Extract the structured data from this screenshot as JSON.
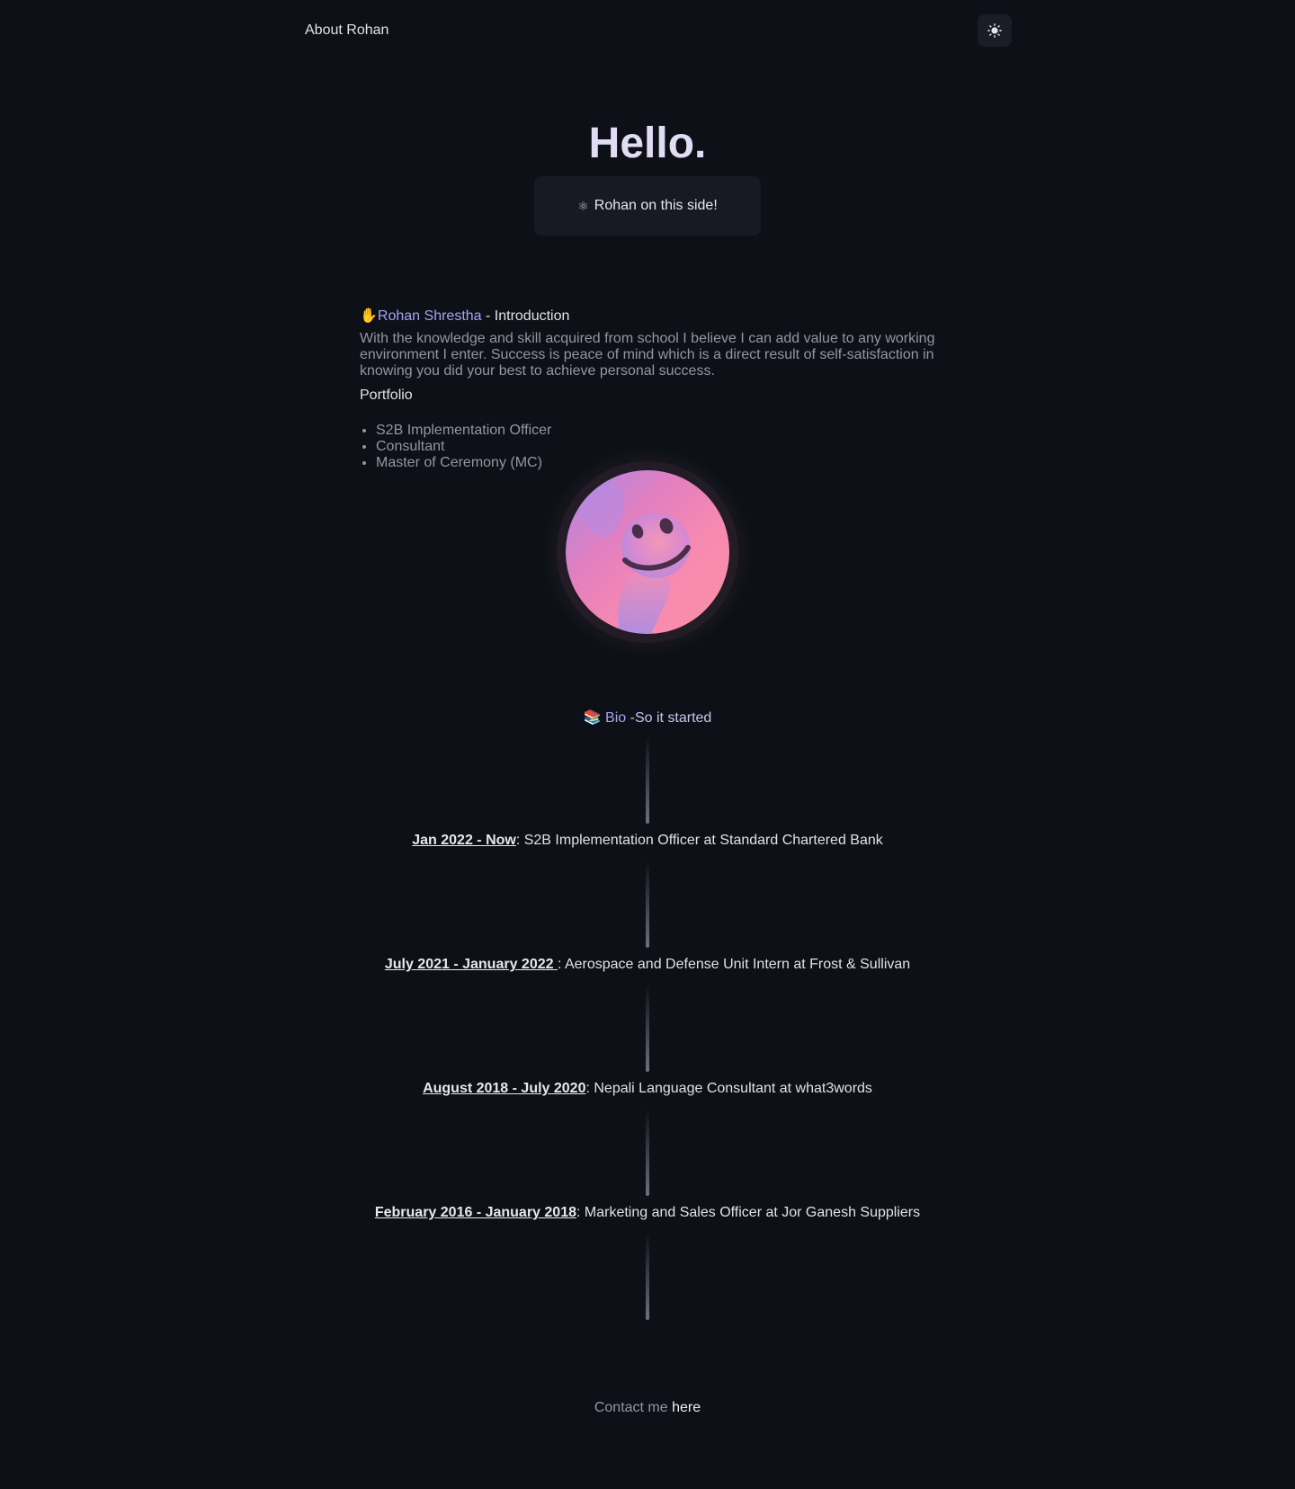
{
  "header": {
    "title": "About Rohan",
    "theme_toggle_icon": "sun-icon"
  },
  "hero": {
    "title": "Hello.",
    "badge_icon": "⚛",
    "badge_text": "Rohan on this side!"
  },
  "intro": {
    "emoji": "✋",
    "name": "Rohan Shrestha",
    "suffix": " - Introduction",
    "text": "With the knowledge and skill acquired from school I believe I can add value to any working environment I enter. Success is peace of mind which is a direct result of self-satisfaction in knowing you did your best to achieve personal success.",
    "portfolio_label": "Portfolio",
    "portfolio_items": [
      "S2B Implementation Officer",
      "Consultant",
      "Master of Ceremony (MC)"
    ]
  },
  "bio": {
    "emoji": "📚",
    "link": "Bio",
    "suffix": " -So it started"
  },
  "timeline": [
    {
      "date": "Jan 2022 - Now",
      "text": ": S2B Implementation Officer at Standard Chartered Bank"
    },
    {
      "date": "July 2021 - January 2022 ",
      "text": ": Aerospace and Defense Unit Intern at Frost & Sullivan"
    },
    {
      "date": "August 2018 - July 2020",
      "text": ": Nepali Language Consultant at what3words"
    },
    {
      "date": "February 2016 - January 2018",
      "text": ": Marketing and Sales Officer at Jor Ganesh Suppliers"
    }
  ],
  "contact": {
    "prefix": "Contact me ",
    "link": "here"
  },
  "colors": {
    "background": "#0d1017",
    "accent": "#a6a4f2",
    "muted_text": "#9496a0"
  }
}
